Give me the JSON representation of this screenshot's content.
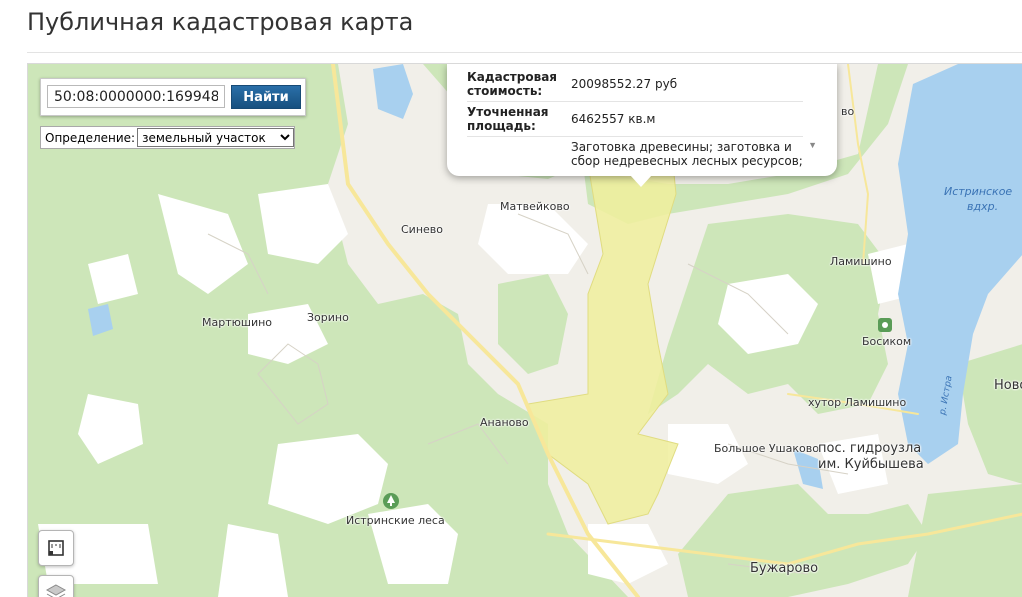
{
  "page": {
    "title": "Публичная кадастровая карта"
  },
  "search": {
    "value": "50:08:0000000:169948",
    "button_label": "Найти"
  },
  "definition": {
    "label": "Определение:",
    "selected": "земельный участок"
  },
  "popup": {
    "rows": [
      {
        "key": "Кадастровая стоимость:",
        "value": "20098552.27 руб"
      },
      {
        "key": "Уточненная площадь:",
        "value": "6462557 кв.м"
      },
      {
        "key": "",
        "value": "Заготовка древесины; заготовка и сбор недревесных лесных ресурсов;"
      }
    ]
  },
  "map_labels": {
    "matveykovo": "Матвейково",
    "sinevo": "Синево",
    "zorino": "Зорино",
    "martyushino": "Мартюшино",
    "ananovo": "Ананово",
    "istrinskie_lesa": "Истринские леса",
    "lamishino": "Ламишино",
    "bosikom": "Босиком",
    "khutor_lamishino": "хутор Ламишино",
    "bolshoe_ushakovo": "Большое Ушаково",
    "pos_gidrouzla": "пос. гидроузла",
    "im_kuybysheva": "им. Куйбышева",
    "buzharovo": "Бужарово",
    "novo": "Ново",
    "vo_top": "во",
    "reservoir_1": "Истринское",
    "reservoir_2": "вдхр.",
    "river": "р. Истра"
  },
  "colors": {
    "forest": "#cde6b9",
    "field": "#f1efe9",
    "water": "#a8d0ef",
    "parcel": "#f0ee9c",
    "road": "#f7e79a",
    "button": "#1f5f93",
    "water_label": "#3a73b5"
  },
  "icons": [
    "park-icon",
    "square-ruler-icon",
    "layers-icon",
    "chevron-down-icon"
  ]
}
